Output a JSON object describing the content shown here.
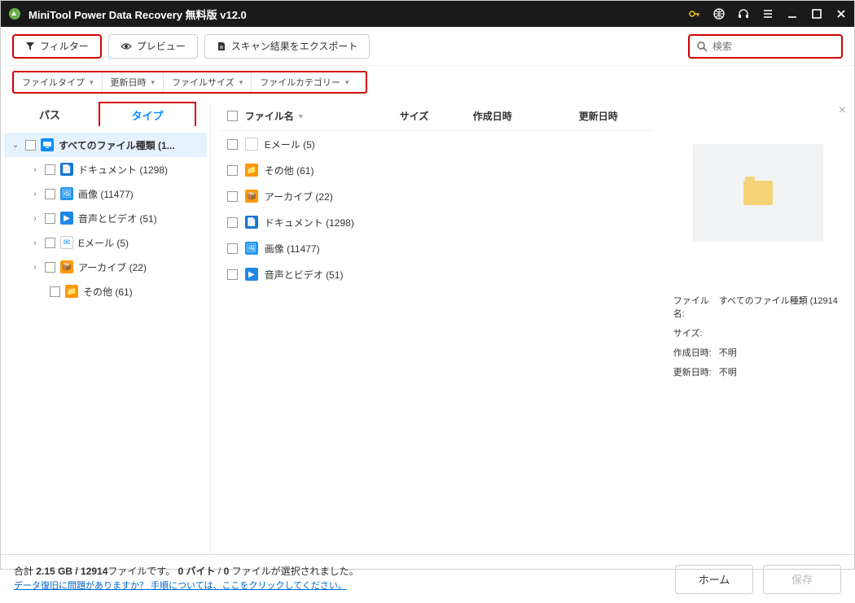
{
  "titlebar": {
    "title": "MiniTool Power Data Recovery 無料版 v12.0"
  },
  "toolbar": {
    "filter_label": "フィルター",
    "preview_label": "プレビュー",
    "export_label": "スキャン結果をエクスポート"
  },
  "search": {
    "placeholder": "検索"
  },
  "filters": {
    "file_type": "ファイルタイプ",
    "mod_date": "更新日時",
    "file_size": "ファイルサイズ",
    "file_category": "ファイルカテゴリー"
  },
  "tabs": {
    "path": "パス",
    "type": "タイプ"
  },
  "tree": {
    "root": "すべてのファイル種類 (1...",
    "doc": "ドキュメント (1298)",
    "img": "画像 (11477)",
    "av": "音声とビデオ (51)",
    "mail": "Eメール (5)",
    "arc": "アーカイブ (22)",
    "oth": "その他 (61)"
  },
  "list": {
    "hdr_name": "ファイル名",
    "hdr_size": "サイズ",
    "hdr_cdate": "作成日時",
    "hdr_mdate": "更新日時",
    "rows": {
      "mail": "Eメール (5)",
      "oth": "その他 (61)",
      "arc": "アーカイブ (22)",
      "doc": "ドキュメント (1298)",
      "img": "画像 (11477)",
      "av": "音声とビデオ (51)"
    }
  },
  "preview": {
    "fname_label": "ファイル名:",
    "fname_val": "すべてのファイル種類 (12914",
    "size_label": "サイズ:",
    "size_val": "",
    "cdate_label": "作成日時:",
    "cdate_val": "不明",
    "mdate_label": "更新日時:",
    "mdate_val": "不明"
  },
  "footer": {
    "line1_a": "合計 ",
    "line1_b": "2.15 GB / 12914",
    "line1_c": "ファイルです。 ",
    "line1_d": "0 バイト",
    "line1_e": " / ",
    "line1_f": "0",
    "line1_g": " ファイルが選択されました。",
    "line2": "データ復旧に問題がありますか？ 手順については、ここをクリックしてください。",
    "home": "ホーム",
    "save": "保存"
  }
}
